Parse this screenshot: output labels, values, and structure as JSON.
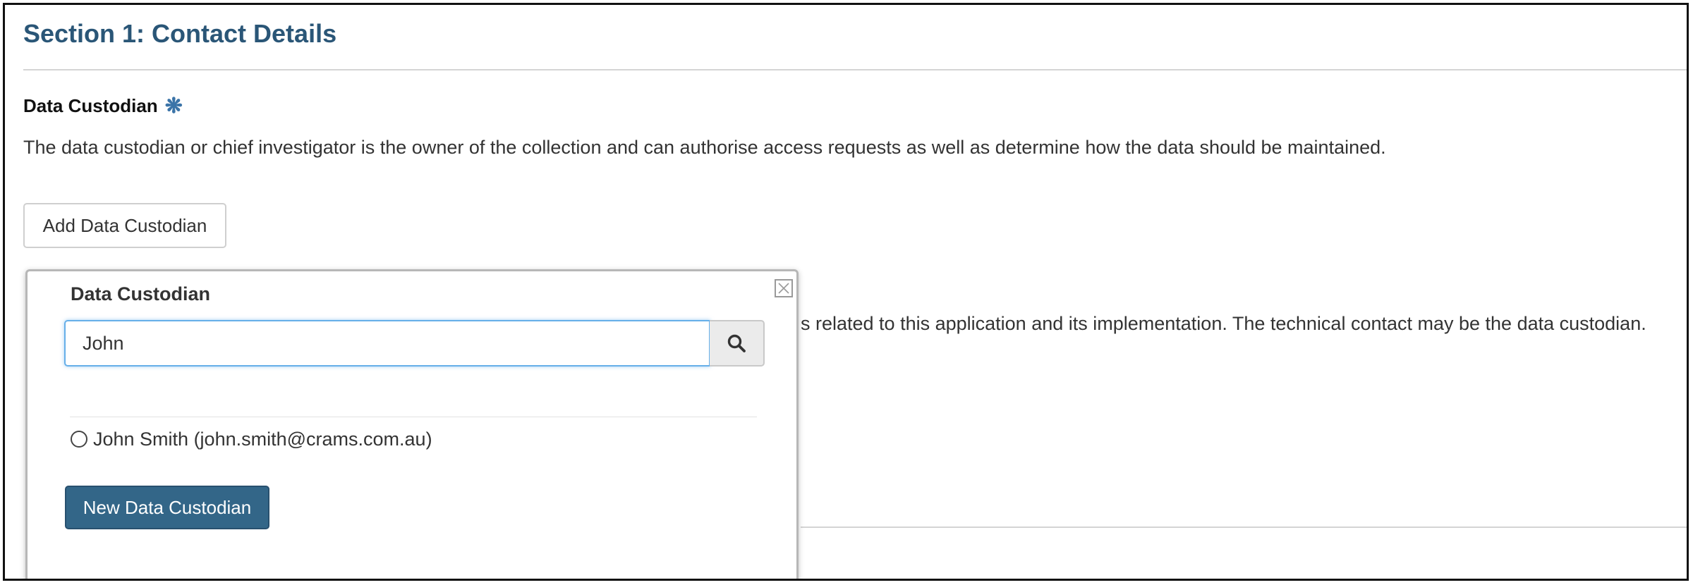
{
  "section": {
    "title": "Section 1: Contact Details"
  },
  "data_custodian": {
    "heading": "Data Custodian",
    "required_icon": "asterisk-icon",
    "description": "The data custodian or chief investigator is the owner of the collection and can authorise access requests as well as determine how the data should be maintained.",
    "add_button_label": "Add Data Custodian"
  },
  "technical_contact": {
    "description_partial": "s related to this application and its implementation. The technical contact may be the data custodian."
  },
  "popup": {
    "title": "Data Custodian",
    "close_icon": "close-icon",
    "search": {
      "value": "John",
      "icon": "search-icon"
    },
    "results": [
      {
        "label": "John Smith (john.smith@crams.com.au)",
        "selected": false
      }
    ],
    "new_button_label": "New Data Custodian"
  },
  "colors": {
    "title": "#2a5677",
    "required": "#3b74a8",
    "primary_button": "#336688",
    "focus_border": "#66afe9"
  }
}
